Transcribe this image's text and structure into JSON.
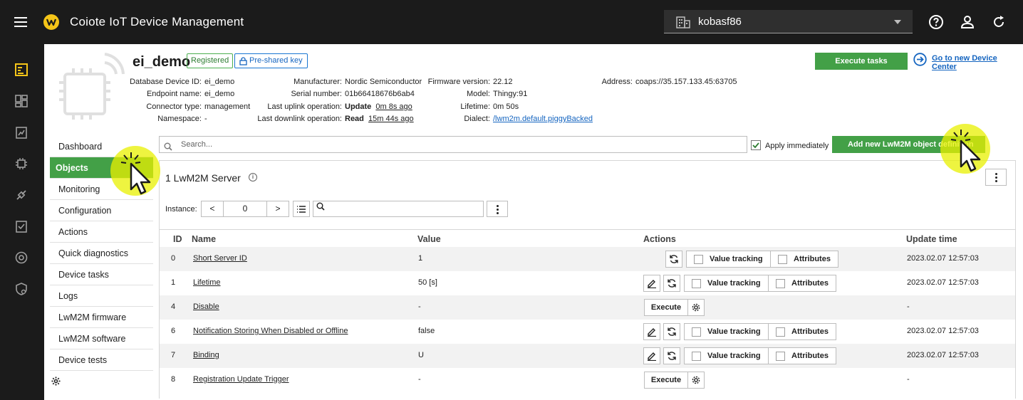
{
  "app": {
    "title": "Coiote IoT Device Management",
    "tenant": "kobasf86"
  },
  "device": {
    "name": "ei_demo",
    "status_badge": "Registered",
    "security_badge": "Pre-shared key",
    "fields": {
      "db_id_label": "Database Device ID:",
      "db_id": "ei_demo",
      "endpoint_label": "Endpoint name:",
      "endpoint": "ei_demo",
      "connector_label": "Connector type:",
      "connector": "management",
      "namespace_label": "Namespace:",
      "namespace": "-",
      "manufacturer_label": "Manufacturer:",
      "manufacturer": "Nordic Semiconductor",
      "serial_label": "Serial number:",
      "serial": "01b66418676b6ab4",
      "uplink_label": "Last uplink operation:",
      "uplink_op": "Update",
      "uplink_time": "0m 8s ago",
      "downlink_label": "Last downlink operation:",
      "downlink_op": "Read",
      "downlink_time": "15m 44s ago",
      "firmware_label": "Firmware version:",
      "firmware": "22.12",
      "model_label": "Model:",
      "model": "Thingy:91",
      "lifetime_label": "Lifetime:",
      "lifetime": "0m 50s",
      "dialect_label": "Dialect:",
      "dialect": "/lwm2m.default.piggyBacked",
      "address_label": "Address:",
      "address": "coaps://35.157.133.45:63705"
    },
    "execute_tasks_label": "Execute tasks",
    "go_new_label": "Go to new Device Center"
  },
  "nav": {
    "items": [
      "Dashboard",
      "Objects",
      "Monitoring",
      "Configuration",
      "Actions",
      "Quick diagnostics",
      "Device tasks",
      "Logs",
      "LwM2M firmware",
      "LwM2M software",
      "Device tests"
    ],
    "active": "Objects"
  },
  "toolbar": {
    "search_placeholder": "Search...",
    "apply_label": "Apply immediately",
    "apply_checked": true,
    "add_label": "Add new LwM2M object definition"
  },
  "object": {
    "title": "1 LwM2M Server",
    "info_icon": "i",
    "instance_label": "Instance:",
    "instance_value": "0",
    "prev": "<",
    "next": ">"
  },
  "table": {
    "headers": {
      "id": "ID",
      "name": "Name",
      "value": "Value",
      "actions": "Actions",
      "update": "Update time"
    },
    "labels": {
      "value_tracking": "Value tracking",
      "attributes": "Attributes",
      "execute": "Execute"
    },
    "rows": [
      {
        "id": "0",
        "name": "Short Server ID",
        "value": "1",
        "update": "2023.02.07 12:57:03",
        "type": "read"
      },
      {
        "id": "1",
        "name": "Lifetime",
        "value": "50 [s]",
        "update": "2023.02.07 12:57:03",
        "type": "write"
      },
      {
        "id": "4",
        "name": "Disable",
        "value": "-",
        "update": "-",
        "type": "exec"
      },
      {
        "id": "6",
        "name": "Notification Storing When Disabled or Offline",
        "value": "false",
        "update": "2023.02.07 12:57:03",
        "type": "write"
      },
      {
        "id": "7",
        "name": "Binding",
        "value": "U",
        "update": "2023.02.07 12:57:03",
        "type": "write"
      },
      {
        "id": "8",
        "name": "Registration Update Trigger",
        "value": "-",
        "update": "-",
        "type": "exec"
      }
    ]
  },
  "colors": {
    "accent": "#43a047",
    "topbar": "#1b1b1b",
    "link": "#1565c0",
    "highlight": "#e8f000"
  }
}
